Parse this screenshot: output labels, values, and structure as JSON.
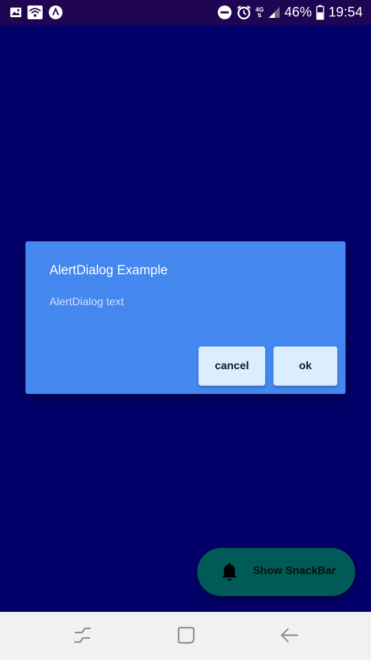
{
  "status_bar": {
    "left_icons": [
      "image-icon",
      "wifi-icon",
      "app-icon"
    ],
    "right_icons": [
      "do-not-disturb-icon",
      "alarm-icon",
      "network-4g-icon",
      "signal-icon",
      "battery-icon"
    ],
    "network_label": "4G",
    "battery_percent": "46%",
    "time": "19:54"
  },
  "dialog": {
    "title": "AlertDialog Example",
    "text": "AlertDialog text",
    "buttons": {
      "cancel": "cancel",
      "ok": "ok"
    }
  },
  "fab": {
    "icon": "bell-icon",
    "label": "Show SnackBar"
  },
  "nav_bar": {
    "icons": [
      "recent-apps-icon",
      "home-icon",
      "back-icon"
    ]
  },
  "colors": {
    "background": "#030069",
    "status_bar": "#1f0552",
    "dialog": "#4487ef",
    "dialog_button": "#dbeefd",
    "fab": "#005a57",
    "nav_bar": "#f1f1f1"
  }
}
